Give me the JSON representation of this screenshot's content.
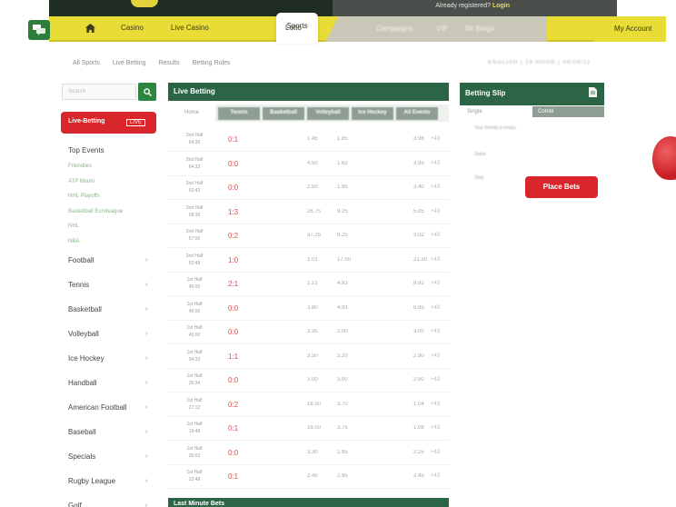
{
  "header": {
    "registered_text": "Already registered?",
    "login_label": "Login"
  },
  "nav": {
    "items": [
      "Casino",
      "Live Casino",
      "Sports",
      "Lotto"
    ],
    "blurred": [
      "Campaigns",
      "VIP",
      "Bit Bingo"
    ],
    "my_account": "My Account"
  },
  "subnav": {
    "links": [
      "All Sports",
      "Live Betting",
      "Results",
      "Betting Rules"
    ],
    "right_text": "ENGLISH  |  24-HOUR  |  04/06/11"
  },
  "sidebar": {
    "search_placeholder": "Search",
    "live_betting_label": "Live-Betting",
    "live_badge": "LIVE",
    "top_events_title": "Top Events",
    "top_event_links": [
      "Friendlies",
      "ATP Miami",
      "NHL Playoffs",
      "Basketball Euroleague",
      "NHL",
      "NBA"
    ],
    "sports": [
      "Football",
      "Tennis",
      "Basketball",
      "Volleyball",
      "Ice Hockey",
      "Handball",
      "American Football",
      "Baseball",
      "Specials",
      "Rugby League",
      "Golf"
    ]
  },
  "live_betting": {
    "title": "Live Betting",
    "active_tab": "Home",
    "columns": [
      "Tennis",
      "Basketball",
      "Volleyball",
      "Ice Hockey",
      "All Events"
    ],
    "rows": [
      {
        "time": "2nd Half\n64:36",
        "score": "0:1",
        "o1": "1.45",
        "o2": "1.85",
        "o3": "3.96"
      },
      {
        "time": "2nd Half\n64:33",
        "score": "0:0",
        "o1": "4.50",
        "o2": "1.62",
        "o3": "3.95"
      },
      {
        "time": "2nd Half\n63:42",
        "score": "0:0",
        "o1": "2.50",
        "o2": "1.95",
        "o3": "3.40"
      },
      {
        "time": "2nd Half\n58:36",
        "score": "1:3",
        "o1": "26.75",
        "o2": "9.25",
        "o3": "5.05"
      },
      {
        "time": "2nd Half\n57:00",
        "score": "0:2",
        "o1": "37.25",
        "o2": "9.25",
        "o3": "3.02"
      },
      {
        "time": "2nd Half\n52:48",
        "score": "1:0",
        "o1": "1.01",
        "o2": "17.50",
        "o3": "21.50"
      },
      {
        "time": "1st Half\n45:00",
        "score": "2:1",
        "o1": "1.21",
        "o2": "4.93",
        "o3": "8.92"
      },
      {
        "time": "1st Half\n45:00",
        "score": "0:0",
        "o1": "3.80",
        "o2": "4.93",
        "o3": "6.95"
      },
      {
        "time": "1st Half\n45:00",
        "score": "0:0",
        "o1": "3.35",
        "o2": "2.00",
        "o3": "3.00"
      },
      {
        "time": "1st Half\n34:33",
        "score": "1:1",
        "o1": "3.50",
        "o2": "3.20",
        "o3": "2.90"
      },
      {
        "time": "1st Half\n26:34",
        "score": "0:0",
        "o1": "3.00",
        "o2": "3.00",
        "o3": "2.90"
      },
      {
        "time": "1st Half\n27:12",
        "score": "0:2",
        "o1": "16.50",
        "o2": "3.70",
        "o3": "1.04"
      },
      {
        "time": "1st Half\n19:48",
        "score": "0:1",
        "o1": "16.00",
        "o2": "3.75",
        "o3": "1.08"
      },
      {
        "time": "1st Half\n26:03",
        "score": "0:0",
        "o1": "3.30",
        "o2": "2.95",
        "o3": "2.25"
      },
      {
        "time": "1st Half\n23:48",
        "score": "0:1",
        "o1": "2.45",
        "o2": "2.95",
        "o3": "2.45"
      }
    ],
    "more_label": "+43"
  },
  "last_minute": {
    "title": "Last Minute Bets"
  },
  "betting_slip": {
    "title": "Betting Slip",
    "tabs": [
      "Single",
      "Combi"
    ],
    "lines": [
      "Your betslip is empty",
      "Stake",
      "Total"
    ],
    "place_bets": "Place Bets"
  },
  "colors": {
    "brand_green": "#2c6446",
    "nav_yellow": "#e9dc36",
    "cta_red": "#d9262b",
    "score_red": "#d35050"
  }
}
